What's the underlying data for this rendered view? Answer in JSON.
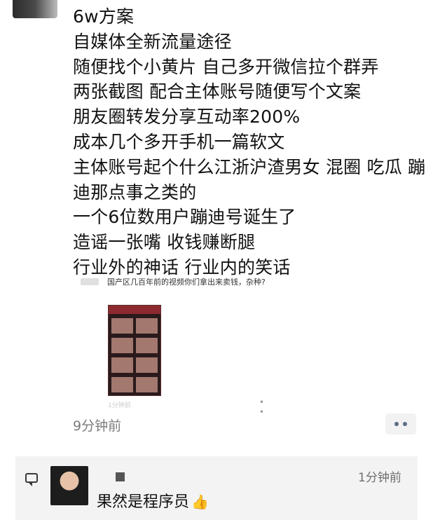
{
  "post": {
    "lines": [
      "6w方案",
      "自媒体全新流量途径",
      "随便找个小黄片 自己多开微信拉个群弄",
      "两张截图 配合主体账号随便写个文案",
      "朋友圈转发分享互动率200%",
      "成本几个多开手机一篇软文",
      "主体账号起个什么江浙沪渣男女 混圈 吃瓜 蹦迪那点事之类的",
      "一个6位数用户蹦迪号诞生了",
      "造谣一张嘴 收钱赚断腿",
      "行业外的神话 行业内的笑话"
    ],
    "time_ago": "9分钟前"
  },
  "share": {
    "title": "国产区几百年前的视频你们拿出来卖钱，杂种?",
    "time": "1分钟前"
  },
  "comment": {
    "time": "1分钟前",
    "text": "果然是程序员",
    "emoji": "👍"
  },
  "icons": {
    "more": "more-dots-icon",
    "comment": "comment-icon",
    "like": "thumbs-up-icon"
  }
}
